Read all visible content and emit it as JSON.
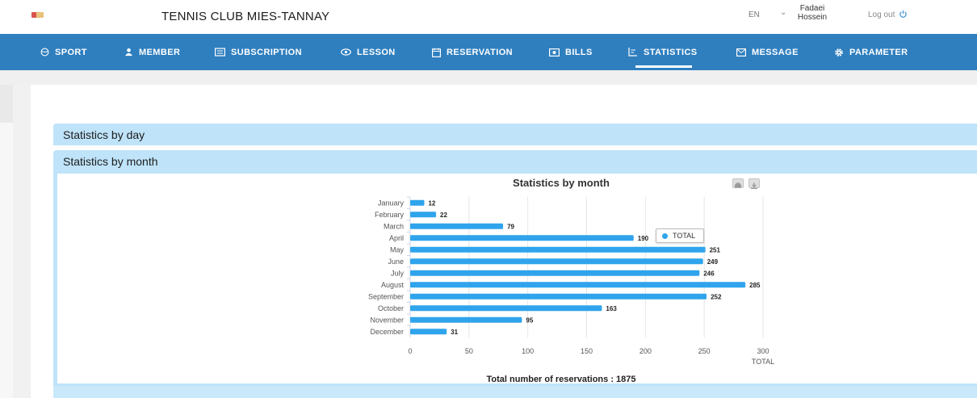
{
  "header": {
    "club_title": "TENNIS CLUB MIES-TANNAY",
    "language": "EN",
    "user_first": "Fadaei",
    "user_last": "Hossein",
    "logout_label": "Log out"
  },
  "nav": {
    "items": [
      {
        "label": "SPORT",
        "icon": "sport-icon"
      },
      {
        "label": "MEMBER",
        "icon": "member-icon"
      },
      {
        "label": "SUBSCRIPTION",
        "icon": "subscription-icon"
      },
      {
        "label": "LESSON",
        "icon": "lesson-icon"
      },
      {
        "label": "RESERVATION",
        "icon": "calendar-icon"
      },
      {
        "label": "BILLS",
        "icon": "bills-icon"
      },
      {
        "label": "STATISTICS",
        "icon": "statistics-icon"
      },
      {
        "label": "MESSAGE",
        "icon": "mail-icon"
      },
      {
        "label": "PARAMETER",
        "icon": "gear-icon"
      }
    ],
    "active": "STATISTICS"
  },
  "sections": {
    "by_day": "Statistics by day",
    "by_month": "Statistics by month"
  },
  "total_text": "Total number of reservations : 1875",
  "colors": {
    "nav": "#2f7fbf",
    "bar": "#2fa4ec",
    "panel": "#bfe3f9"
  },
  "chart_data": {
    "type": "bar",
    "orientation": "horizontal",
    "title": "Statistics by month",
    "categories": [
      "January",
      "February",
      "March",
      "April",
      "May",
      "June",
      "July",
      "August",
      "September",
      "October",
      "November",
      "December"
    ],
    "series": [
      {
        "name": "TOTAL",
        "values": [
          12,
          22,
          79,
          190,
          251,
          249,
          246,
          285,
          252,
          163,
          95,
          31
        ]
      }
    ],
    "xlabel": "TOTAL",
    "xlim": [
      0,
      300
    ],
    "xticks": [
      0,
      50,
      100,
      150,
      200,
      250,
      300
    ],
    "grid": true,
    "legend": "right"
  }
}
